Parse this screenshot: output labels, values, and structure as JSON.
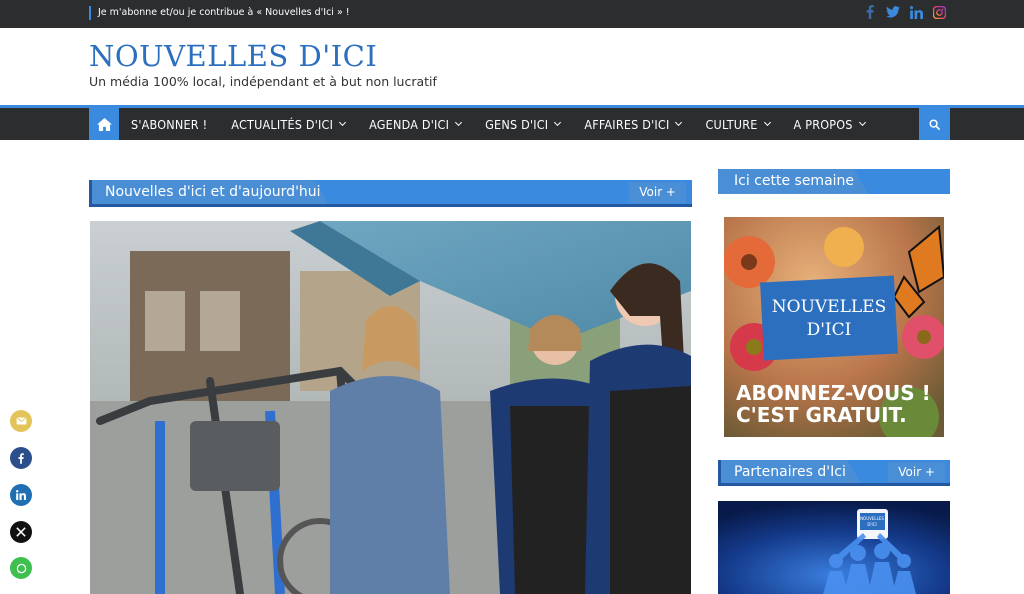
{
  "topbar": {
    "promo_text": "Je m'abonne et/ou je contribue à « Nouvelles d'Ici » !",
    "social": [
      "facebook-icon",
      "twitter-icon",
      "linkedin-icon",
      "instagram-icon"
    ]
  },
  "header": {
    "logo": "NOUVELLES D'ICI",
    "tagline": "Un média 100% local, indépendant et à but non lucratif"
  },
  "nav": {
    "items": [
      {
        "label": "S'ABONNER !",
        "dropdown": false
      },
      {
        "label": "ACTUALITÉS D'ICI",
        "dropdown": true
      },
      {
        "label": "AGENDA D'ICI",
        "dropdown": true
      },
      {
        "label": "GENS D'ICI",
        "dropdown": true
      },
      {
        "label": "AFFAIRES D'ICI",
        "dropdown": true
      },
      {
        "label": "CULTURE",
        "dropdown": true
      },
      {
        "label": "A PROPOS",
        "dropdown": true
      }
    ]
  },
  "main": {
    "section_title": "Nouvelles d'ici et d'aujourd'hui",
    "more_label": "Voir +"
  },
  "sidebar": {
    "week_title": "Ici cette semaine",
    "promo": {
      "logo_line1": "NOUVELLES",
      "logo_line2": "D'ICI",
      "cta_line1": "ABONNEZ-VOUS !",
      "cta_line2": "C'EST GRATUIT."
    },
    "partners_title": "Partenaires d'Ici",
    "partners_more": "Voir +",
    "partners_logo_line1": "NOUVELLES",
    "partners_logo_line2": "D'ICI"
  },
  "colors": {
    "accent": "#3a8be0",
    "dark_bar": "#2b2d2f",
    "brand_blue": "#2d6fbf"
  },
  "share": [
    "email-icon",
    "facebook-icon",
    "linkedin-icon",
    "x-icon",
    "whatsapp-icon"
  ]
}
